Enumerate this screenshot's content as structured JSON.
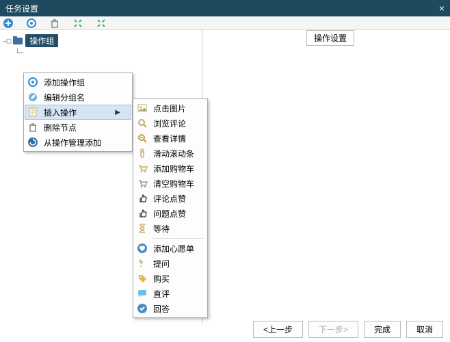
{
  "window": {
    "title": "任务设置",
    "close": "×"
  },
  "tree": {
    "root_label": "操作组"
  },
  "panel": {
    "label": "操作设置"
  },
  "menu1": {
    "items": [
      {
        "label": "添加操作组",
        "icon": "gear-plus-icon"
      },
      {
        "label": "编辑分组名",
        "icon": "edit-icon"
      },
      {
        "label": "插入操作",
        "icon": "page-icon",
        "hovered": true,
        "submenu": true
      },
      {
        "label": "删除节点",
        "icon": "trash-icon"
      },
      {
        "label": "从操作管理添加",
        "icon": "refresh-icon"
      }
    ]
  },
  "menu2": {
    "groups": [
      [
        {
          "label": "点击图片",
          "icon": "picture-icon"
        },
        {
          "label": "浏览评论",
          "icon": "search-icon"
        },
        {
          "label": "查看详情",
          "icon": "zoom-icon"
        },
        {
          "label": "滑动滚动条",
          "icon": "scroll-icon"
        },
        {
          "label": "添加购物车",
          "icon": "cart-add-icon"
        },
        {
          "label": "清空购物车",
          "icon": "cart-clear-icon"
        },
        {
          "label": "评论点赞",
          "icon": "thumb-icon"
        },
        {
          "label": "问题点赞",
          "icon": "thumb-icon"
        },
        {
          "label": "等待",
          "icon": "hourglass-icon"
        }
      ],
      [
        {
          "label": "添加心愿单",
          "icon": "heart-icon"
        },
        {
          "label": "提问",
          "icon": "question-icon"
        },
        {
          "label": "购买",
          "icon": "tag-icon"
        },
        {
          "label": "直评",
          "icon": "comment-icon"
        },
        {
          "label": "回答",
          "icon": "answer-icon"
        }
      ]
    ]
  },
  "footer": {
    "prev": "<上一步",
    "next": "下一步>",
    "finish": "完成",
    "cancel": "取消"
  }
}
